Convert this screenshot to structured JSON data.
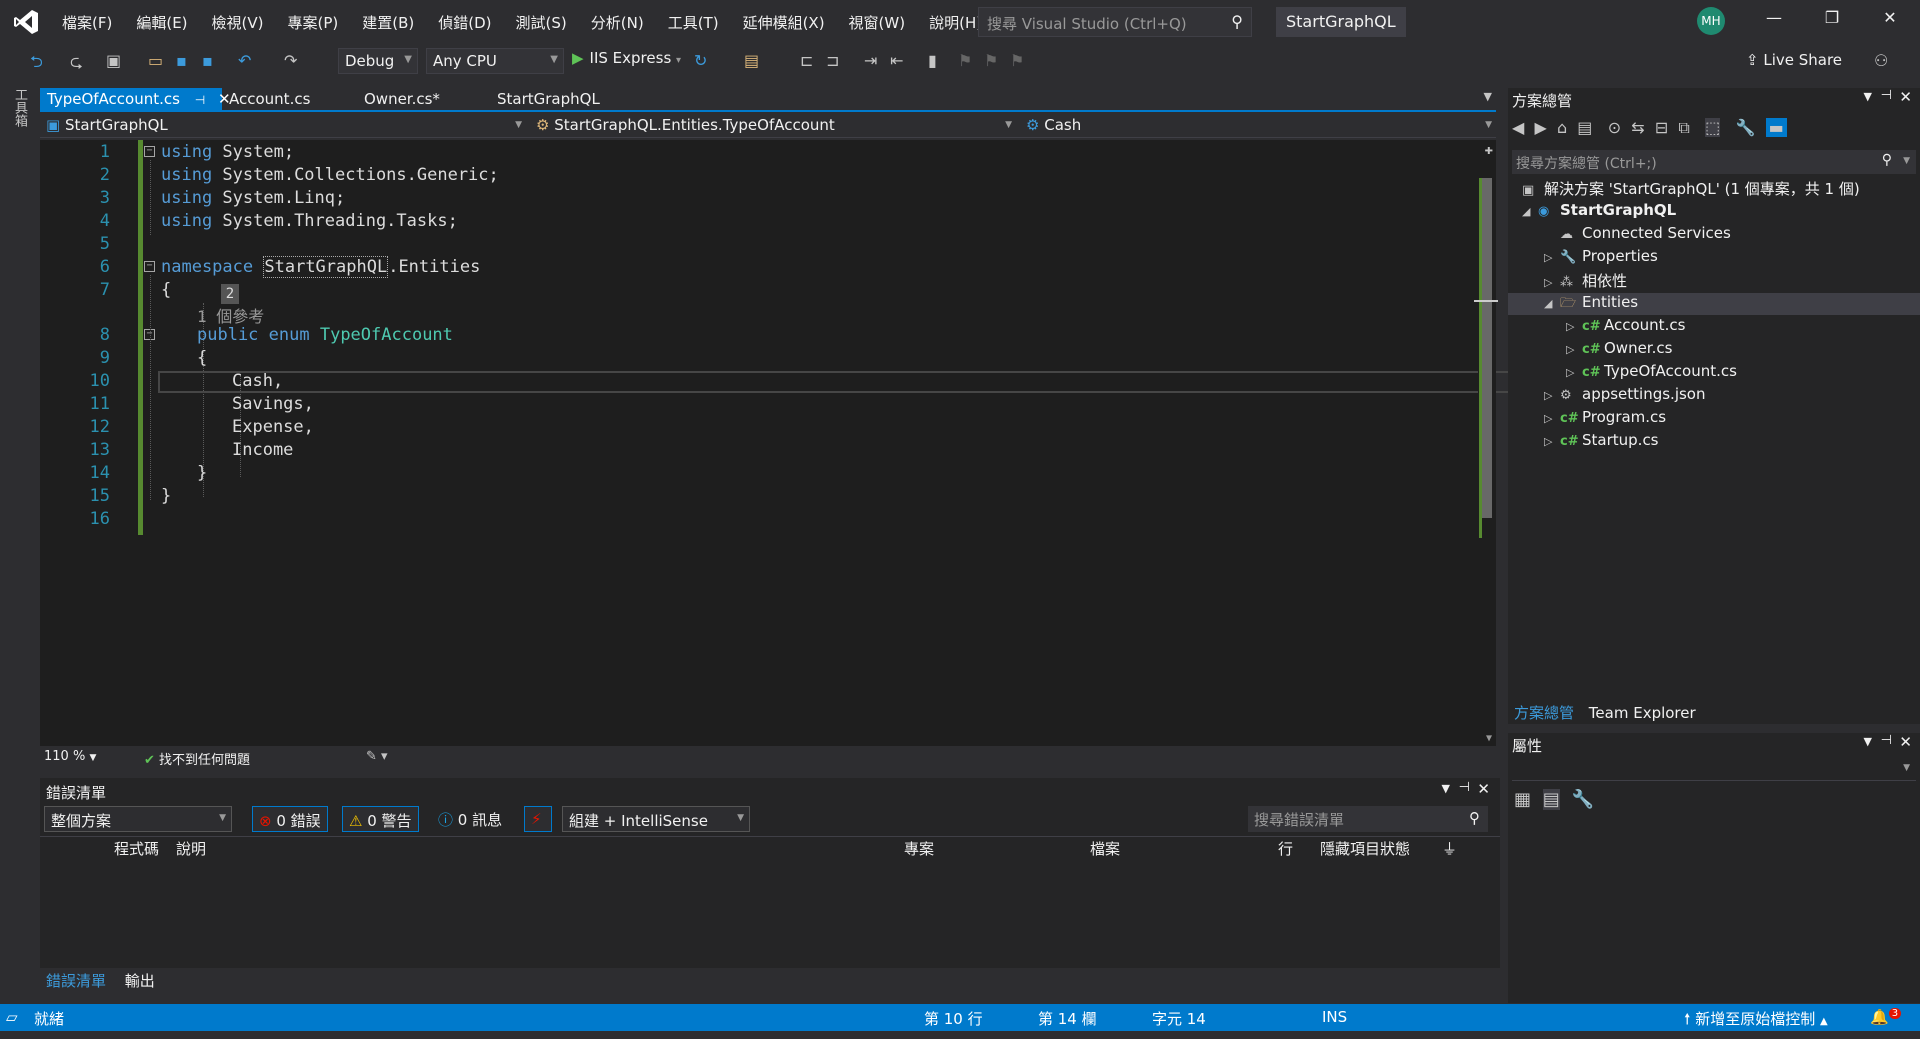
{
  "titlebar": {
    "menu": [
      "檔案(F)",
      "編輯(E)",
      "檢視(V)",
      "專案(P)",
      "建置(B)",
      "偵錯(D)",
      "測試(S)",
      "分析(N)",
      "工具(T)",
      "延伸模組(X)",
      "視窗(W)",
      "說明(H)"
    ],
    "search_placeholder": "搜尋 Visual Studio (Ctrl+Q)",
    "solution_name": "StartGraphQL",
    "avatar_initials": "MH",
    "controls": [
      "—",
      "❐",
      "✕"
    ]
  },
  "toolbar": {
    "config": "Debug",
    "platform": "Any CPU",
    "run_label": "IIS Express",
    "live_share": "Live Share"
  },
  "left_strip": {
    "toolbox": "工具箱"
  },
  "doc_tabs": [
    {
      "label": "TypeOfAccount.cs",
      "active": true
    },
    {
      "label": "Account.cs"
    },
    {
      "label": "Owner.cs*"
    },
    {
      "label": "StartGraphQL"
    }
  ],
  "navbar": {
    "project": "StartGraphQL",
    "type": "StartGraphQL.Entities.TypeOfAccount",
    "member": "Cash"
  },
  "code": {
    "line_numbers": [
      "1",
      "2",
      "3",
      "4",
      "5",
      "6",
      "7",
      "8",
      "9",
      "10",
      "11",
      "12",
      "13",
      "14",
      "15",
      "16"
    ],
    "lines": {
      "l1_kw": "using",
      "l1_rest": " System;",
      "l2_kw": "using",
      "l2_rest": " System.Collections.Generic;",
      "l3_kw": "using",
      "l3_rest": " System.Linq;",
      "l4_kw": "using",
      "l4_rest": " System.Threading.Tasks;",
      "l6_kw": "namespace",
      "l6_ns": "StartGraphQL",
      "l6_rest": ".Entities",
      "l7": "{",
      "ref_lens": "1 個參考",
      "l8_kw": "public enum",
      "l8_ty": "TypeOfAccount",
      "l9": "{",
      "l10": "Cash,",
      "l11": "Savings,",
      "l12": "Expense,",
      "l13": "Income",
      "l14": "}",
      "l15": "}"
    },
    "badge": "2"
  },
  "editor_footer": {
    "zoom": "110 %",
    "issues": "找不到任何問題"
  },
  "error_list": {
    "title": "錯誤清單",
    "scope": "整個方案",
    "errors": "0 錯誤",
    "warnings": "0 警告",
    "messages": "0 訊息",
    "build_filter": "組建 + IntelliSense",
    "search_placeholder": "搜尋錯誤清單",
    "columns": [
      "程式碼",
      "說明",
      "專案",
      "檔案",
      "行",
      "隱藏項目狀態"
    ],
    "bottom_tabs": [
      "錯誤清單",
      "輸出"
    ]
  },
  "solution_explorer": {
    "title": "方案總管",
    "search_placeholder": "搜尋方案總管 (Ctrl+;)",
    "solution_label": "解決方案 'StartGraphQL' (1 個專案，共 1 個)",
    "project": "StartGraphQL",
    "items": {
      "connected": "Connected Services",
      "properties": "Properties",
      "deps": "相依性",
      "entities": "Entities",
      "account": "Account.cs",
      "owner": "Owner.cs",
      "typeofaccount": "TypeOfAccount.cs",
      "appsettings": "appsettings.json",
      "program": "Program.cs",
      "startup": "Startup.cs"
    },
    "bottom_tabs": [
      "方案總管",
      "Team Explorer"
    ]
  },
  "properties_panel": {
    "title": "屬性"
  },
  "statusbar": {
    "ready": "就緒",
    "line": "第 10 行",
    "col": "第 14 欄",
    "char": "字元 14",
    "mode": "INS",
    "source_control": "新增至原始檔控制",
    "notifications": "3"
  },
  "colors": {
    "accent": "#007acc",
    "keyword": "#569cd6",
    "type": "#4ec9b0",
    "line_number": "#2b91af",
    "change_bar": "#578a30"
  }
}
